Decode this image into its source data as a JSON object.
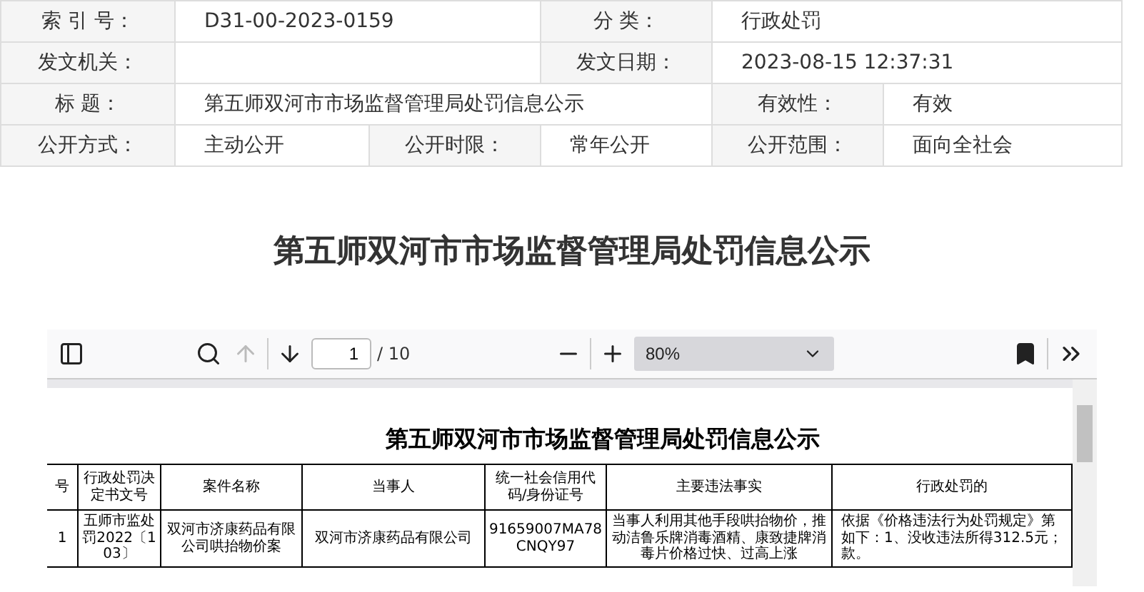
{
  "meta": [
    [
      {
        "label": "索 引 号：",
        "value": "D31-00-2023-0159"
      },
      {
        "label": "分 类：",
        "value": "行政处罚"
      }
    ],
    [
      {
        "label": "发文机关："
      },
      {
        "label": "发文日期：",
        "value": "2023-08-15 12:37:31"
      }
    ],
    [
      {
        "label": "标 题：",
        "value": "第五师双河市市场监督管理局处罚信息公示"
      },
      {
        "label": "有效性：",
        "value": "有效"
      }
    ],
    [
      {
        "label": "公开方式：",
        "value": "主动公开"
      },
      {
        "label": "公开时限：",
        "value": "常年公开"
      },
      {
        "label": "公开范围：",
        "value": "面向全社会"
      }
    ]
  ],
  "heading": "第五师双河市市场监督管理局处罚信息公示",
  "viewer": {
    "page": "1",
    "total": "/ 10",
    "zoom": "80%",
    "up_disabled": true,
    "document": {
      "title": "第五师双河市市场监督管理局处罚信息公示",
      "columns": [
        "号",
        "行政处罚决定书文号",
        "案件名称",
        "当事人",
        "统一社会信用代码/身份证号",
        "主要违法事实",
        "行政处罚的"
      ],
      "rows": [
        [
          "1",
          "五师市监处罚2022〔103〕",
          "双河市济康药品有限公司哄抬物价案",
          "双河市济康药品有限公司",
          "91659007MA78CNQY97",
          "当事人利用其他手段哄抬物价，推动洁鲁乐牌消毒酒精、康致捷牌消毒片价格过快、过高上涨",
          [
            "依据《价格违法行为处罚规定》第",
            "如下：1、没收违法所得312.5元；",
            "款。"
          ]
        ]
      ]
    }
  }
}
